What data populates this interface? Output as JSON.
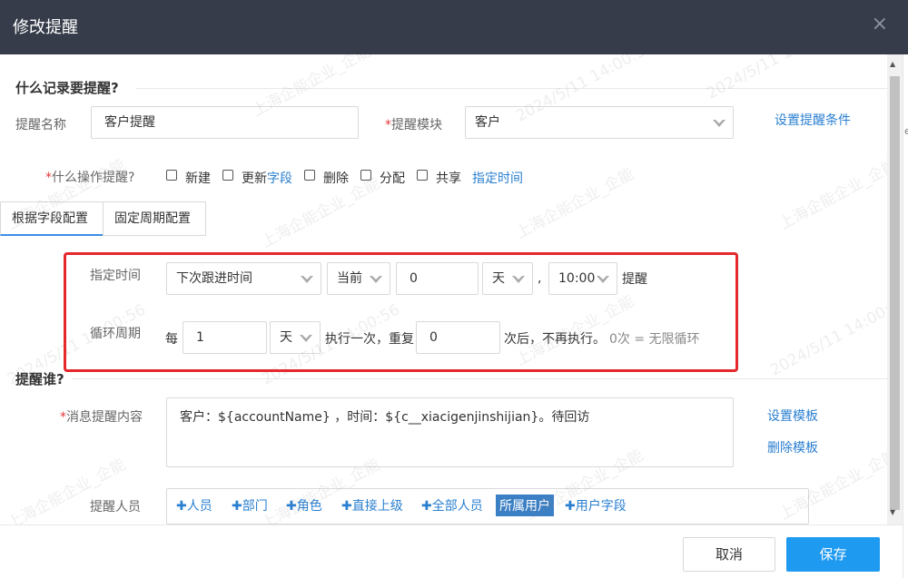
{
  "dialog": {
    "title": "修改提醒",
    "close_glyph": "×"
  },
  "section1": {
    "title": "什么记录要提醒?",
    "name_label": "提醒名称",
    "name_value": "客户提醒",
    "module_label": "提醒模块",
    "module_value": "客户",
    "condition_link": "设置提醒条件",
    "op_label": "什么操作提醒?",
    "ops": [
      {
        "label": "新建",
        "checked": false
      },
      {
        "label": "更新",
        "checked": false
      },
      {
        "label": "删除",
        "checked": false
      },
      {
        "label": "分配",
        "checked": false
      },
      {
        "label": "共享",
        "checked": false
      }
    ],
    "field_link": "字段",
    "time_link": "指定时间"
  },
  "tabs": {
    "by_field": "根据字段配置",
    "fixed_period": "固定周期配置"
  },
  "config": {
    "time_label": "指定时间",
    "time_field": "下次跟进时间",
    "relative": "当前",
    "offset": "0",
    "unit": "天",
    "comma": ",",
    "clock": "10:00",
    "remind_text": "提醒",
    "cycle_label": "循环周期",
    "every": "每",
    "cycle_value": "1",
    "cycle_unit": "天",
    "exec_text": "执行一次，重复",
    "repeat_value": "0",
    "after_text": "次后，不再执行。",
    "hint": "0次 = 无限循环"
  },
  "section2": {
    "title": "提醒谁?",
    "msg_label": "消息提醒内容",
    "msg_value": "客户：${accountName} ，时间：${c__xiacigenjinshijian}。待回访",
    "set_template": "设置模板",
    "delete_template": "删除模板",
    "people_label": "提醒人员",
    "people_tags": [
      "人员",
      "部门",
      "角色",
      "直接上级",
      "全部人员"
    ],
    "selected_tag": "所属用户",
    "user_field_tag": "用户字段",
    "plus_glyph": "✚"
  },
  "footer": {
    "cancel": "取消",
    "save": "保存"
  },
  "watermarks": {
    "company": "上海企能企业_企能",
    "date": "2024/5/11 14:00:56"
  },
  "right_strip_char": "e",
  "colors": {
    "titlebar": "#363c4a",
    "accent": "#1e9af0",
    "link": "#2a7fd0",
    "required": "#e4393c",
    "highlight_box": "#e5282c"
  }
}
